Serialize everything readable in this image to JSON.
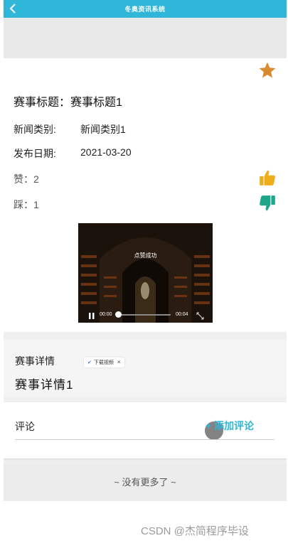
{
  "header": {
    "title": "冬奥资讯系统",
    "back_icon": "chevron-left-icon"
  },
  "event": {
    "title_label": "赛事标题：",
    "title_value": "赛事标题1",
    "category_label": "新闻类别:",
    "category_value": "新闻类别1",
    "date_label": "发布日期:",
    "date_value": "2021-03-20",
    "like_label": "赞：",
    "like_count": "2",
    "dislike_label": "踩：",
    "dislike_count": "1",
    "favorite_icon": "star-icon",
    "colors": {
      "star": "#d98a2e",
      "thumb_up": "#f0ad1a",
      "thumb_down": "#1ea68b"
    }
  },
  "video": {
    "toast": "点赞成功",
    "current_time": "00:00",
    "duration": "00:04",
    "progress": 0
  },
  "detail": {
    "label": "赛事详情",
    "body": "赛事详情1",
    "download_pill": {
      "label": "下载视频",
      "close": "×"
    }
  },
  "comment": {
    "label": "评论",
    "add_button": "+ 添加评论",
    "accent_color": "#2fb6d8"
  },
  "footer": {
    "no_more": "~ 没有更多了 ~",
    "watermark": "CSDN @杰简程序毕设"
  }
}
